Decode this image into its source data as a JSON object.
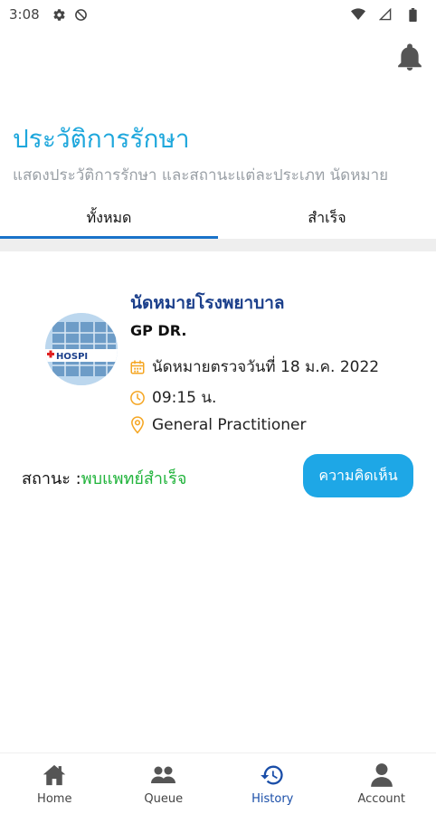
{
  "status_bar": {
    "time": "3:08"
  },
  "header": {
    "title": "ประวัติการรักษา",
    "subtitle": "แสดงประวัติการรักษา และสถานะแต่ละประเภท นัดหมาย"
  },
  "tabs": [
    {
      "label": "ทั้งหมด",
      "active": true
    },
    {
      "label": "สำเร็จ",
      "active": false
    }
  ],
  "appointment": {
    "title": "นัดหมายโรงพยาบาล",
    "doctor": "GP DR.",
    "date": "นัดหมายตรวจวันที่ 18 ม.ค. 2022",
    "time": "09:15 น.",
    "department": "General Practitioner",
    "status_label": "สถานะ :",
    "status_value": "พบแพทย์สำเร็จ",
    "review_button": "ความคิดเห็น",
    "avatar_text": "HOSPI"
  },
  "bottom_nav": [
    {
      "label": "Home",
      "icon": "home-icon",
      "active": false
    },
    {
      "label": "Queue",
      "icon": "queue-icon",
      "active": false
    },
    {
      "label": "History",
      "icon": "history-icon",
      "active": true
    },
    {
      "label": "Account",
      "icon": "account-icon",
      "active": false
    }
  ],
  "colors": {
    "accent": "#1ea7dc",
    "title_blue": "#1b3f8b",
    "success": "#1fb33a",
    "tab_indicator": "#1a73c9",
    "icon_orange": "#f5a623",
    "nav_active": "#1a4ea8"
  }
}
